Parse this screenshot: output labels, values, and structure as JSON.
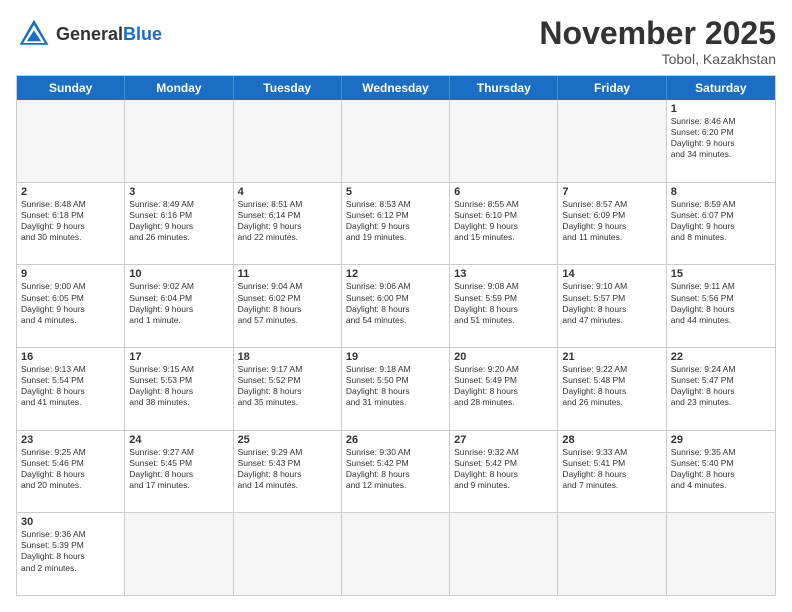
{
  "header": {
    "logo_general": "General",
    "logo_blue": "Blue",
    "month_title": "November 2025",
    "location": "Tobol, Kazakhstan"
  },
  "day_names": [
    "Sunday",
    "Monday",
    "Tuesday",
    "Wednesday",
    "Thursday",
    "Friday",
    "Saturday"
  ],
  "weeks": [
    [
      {
        "date": "",
        "info": "",
        "empty": true
      },
      {
        "date": "",
        "info": "",
        "empty": true
      },
      {
        "date": "",
        "info": "",
        "empty": true
      },
      {
        "date": "",
        "info": "",
        "empty": true
      },
      {
        "date": "",
        "info": "",
        "empty": true
      },
      {
        "date": "",
        "info": "",
        "empty": true
      },
      {
        "date": "1",
        "info": "Sunrise: 8:46 AM\nSunset: 6:20 PM\nDaylight: 9 hours\nand 34 minutes."
      }
    ],
    [
      {
        "date": "2",
        "info": "Sunrise: 8:48 AM\nSunset: 6:18 PM\nDaylight: 9 hours\nand 30 minutes."
      },
      {
        "date": "3",
        "info": "Sunrise: 8:49 AM\nSunset: 6:16 PM\nDaylight: 9 hours\nand 26 minutes."
      },
      {
        "date": "4",
        "info": "Sunrise: 8:51 AM\nSunset: 6:14 PM\nDaylight: 9 hours\nand 22 minutes."
      },
      {
        "date": "5",
        "info": "Sunrise: 8:53 AM\nSunset: 6:12 PM\nDaylight: 9 hours\nand 19 minutes."
      },
      {
        "date": "6",
        "info": "Sunrise: 8:55 AM\nSunset: 6:10 PM\nDaylight: 9 hours\nand 15 minutes."
      },
      {
        "date": "7",
        "info": "Sunrise: 8:57 AM\nSunset: 6:09 PM\nDaylight: 9 hours\nand 11 minutes."
      },
      {
        "date": "8",
        "info": "Sunrise: 8:59 AM\nSunset: 6:07 PM\nDaylight: 9 hours\nand 8 minutes."
      }
    ],
    [
      {
        "date": "9",
        "info": "Sunrise: 9:00 AM\nSunset: 6:05 PM\nDaylight: 9 hours\nand 4 minutes."
      },
      {
        "date": "10",
        "info": "Sunrise: 9:02 AM\nSunset: 6:04 PM\nDaylight: 9 hours\nand 1 minute."
      },
      {
        "date": "11",
        "info": "Sunrise: 9:04 AM\nSunset: 6:02 PM\nDaylight: 8 hours\nand 57 minutes."
      },
      {
        "date": "12",
        "info": "Sunrise: 9:06 AM\nSunset: 6:00 PM\nDaylight: 8 hours\nand 54 minutes."
      },
      {
        "date": "13",
        "info": "Sunrise: 9:08 AM\nSunset: 5:59 PM\nDaylight: 8 hours\nand 51 minutes."
      },
      {
        "date": "14",
        "info": "Sunrise: 9:10 AM\nSunset: 5:57 PM\nDaylight: 8 hours\nand 47 minutes."
      },
      {
        "date": "15",
        "info": "Sunrise: 9:11 AM\nSunset: 5:56 PM\nDaylight: 8 hours\nand 44 minutes."
      }
    ],
    [
      {
        "date": "16",
        "info": "Sunrise: 9:13 AM\nSunset: 5:54 PM\nDaylight: 8 hours\nand 41 minutes."
      },
      {
        "date": "17",
        "info": "Sunrise: 9:15 AM\nSunset: 5:53 PM\nDaylight: 8 hours\nand 38 minutes."
      },
      {
        "date": "18",
        "info": "Sunrise: 9:17 AM\nSunset: 5:52 PM\nDaylight: 8 hours\nand 35 minutes."
      },
      {
        "date": "19",
        "info": "Sunrise: 9:18 AM\nSunset: 5:50 PM\nDaylight: 8 hours\nand 31 minutes."
      },
      {
        "date": "20",
        "info": "Sunrise: 9:20 AM\nSunset: 5:49 PM\nDaylight: 8 hours\nand 28 minutes."
      },
      {
        "date": "21",
        "info": "Sunrise: 9:22 AM\nSunset: 5:48 PM\nDaylight: 8 hours\nand 26 minutes."
      },
      {
        "date": "22",
        "info": "Sunrise: 9:24 AM\nSunset: 5:47 PM\nDaylight: 8 hours\nand 23 minutes."
      }
    ],
    [
      {
        "date": "23",
        "info": "Sunrise: 9:25 AM\nSunset: 5:46 PM\nDaylight: 8 hours\nand 20 minutes."
      },
      {
        "date": "24",
        "info": "Sunrise: 9:27 AM\nSunset: 5:45 PM\nDaylight: 8 hours\nand 17 minutes."
      },
      {
        "date": "25",
        "info": "Sunrise: 9:29 AM\nSunset: 5:43 PM\nDaylight: 8 hours\nand 14 minutes."
      },
      {
        "date": "26",
        "info": "Sunrise: 9:30 AM\nSunset: 5:42 PM\nDaylight: 8 hours\nand 12 minutes."
      },
      {
        "date": "27",
        "info": "Sunrise: 9:32 AM\nSunset: 5:42 PM\nDaylight: 8 hours\nand 9 minutes."
      },
      {
        "date": "28",
        "info": "Sunrise: 9:33 AM\nSunset: 5:41 PM\nDaylight: 8 hours\nand 7 minutes."
      },
      {
        "date": "29",
        "info": "Sunrise: 9:35 AM\nSunset: 5:40 PM\nDaylight: 8 hours\nand 4 minutes."
      }
    ],
    [
      {
        "date": "30",
        "info": "Sunrise: 9:36 AM\nSunset: 5:39 PM\nDaylight: 8 hours\nand 2 minutes."
      },
      {
        "date": "",
        "info": "",
        "empty": true
      },
      {
        "date": "",
        "info": "",
        "empty": true
      },
      {
        "date": "",
        "info": "",
        "empty": true
      },
      {
        "date": "",
        "info": "",
        "empty": true
      },
      {
        "date": "",
        "info": "",
        "empty": true
      },
      {
        "date": "",
        "info": "",
        "empty": true
      }
    ]
  ]
}
